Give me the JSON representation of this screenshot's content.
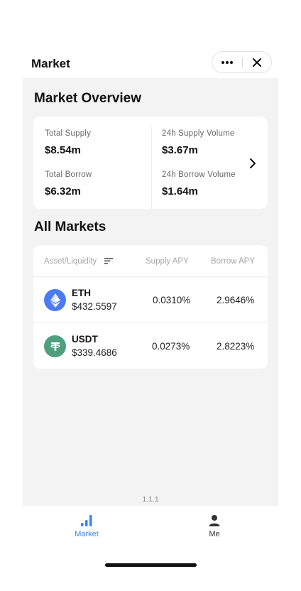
{
  "header": {
    "title": "Market",
    "more_icon": "ellipsis-icon",
    "close_icon": "close-icon"
  },
  "overview": {
    "title": "Market Overview",
    "total_supply_label": "Total Supply",
    "total_supply_value": "$8.54m",
    "total_borrow_label": "Total Borrow",
    "total_borrow_value": "$6.32m",
    "supply_volume_label": "24h Supply Volume",
    "supply_volume_value": "$3.67m",
    "borrow_volume_label": "24h Borrow Volume",
    "borrow_volume_value": "$1.64m",
    "arrow_icon": "chevron-right-icon"
  },
  "markets": {
    "title": "All Markets",
    "col_asset": "Asset/Liquidity",
    "col_supply": "Supply APY",
    "col_borrow": "Borrow APY",
    "sort_icon": "sort-icon",
    "rows": [
      {
        "symbol": "ETH",
        "liquidity": "$432.5597",
        "supply_apy": "0.0310%",
        "borrow_apy": "2.9646%",
        "icon": "ethereum-icon",
        "color": "#4a7bf0"
      },
      {
        "symbol": "USDT",
        "liquidity": "$339.4686",
        "supply_apy": "0.0273%",
        "borrow_apy": "2.8223%",
        "icon": "tether-icon",
        "color": "#4f9f7f"
      }
    ]
  },
  "version": "1.1.1",
  "tabbar": {
    "market_label": "Market",
    "me_label": "Me",
    "active_color": "#3b82f6"
  }
}
